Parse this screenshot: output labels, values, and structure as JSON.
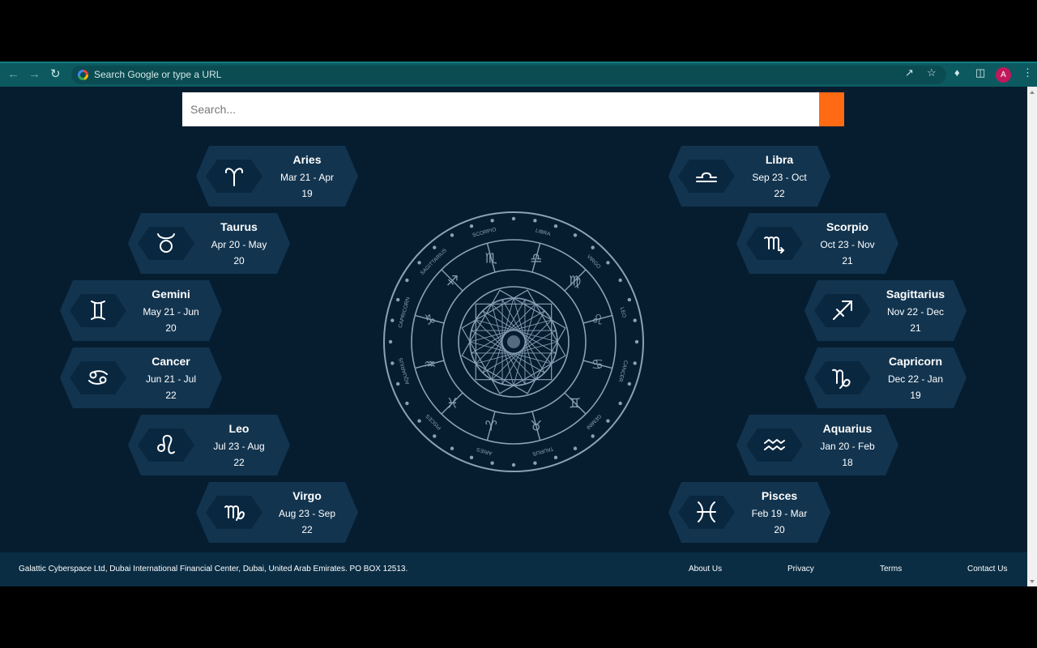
{
  "browser": {
    "omnibox_placeholder": "Search Google or type a URL",
    "profile_initial": "A"
  },
  "search": {
    "placeholder": "Search...",
    "button_color": "#ff6a13"
  },
  "colors": {
    "page_background": "#061d30",
    "card_background": "#12344f",
    "footer_background": "#0a2d44",
    "chrome_background": "#0c5a60"
  },
  "signs": [
    {
      "name": "Aries",
      "dates_line1": "Mar 21 - Apr",
      "dates_line2": "19",
      "icon": "aries-icon"
    },
    {
      "name": "Taurus",
      "dates_line1": "Apr 20 - May",
      "dates_line2": "20",
      "icon": "taurus-icon"
    },
    {
      "name": "Gemini",
      "dates_line1": "May 21 - Jun",
      "dates_line2": "20",
      "icon": "gemini-icon"
    },
    {
      "name": "Cancer",
      "dates_line1": "Jun 21 - Jul",
      "dates_line2": "22",
      "icon": "cancer-icon"
    },
    {
      "name": "Leo",
      "dates_line1": "Jul 23 - Aug",
      "dates_line2": "22",
      "icon": "leo-icon"
    },
    {
      "name": "Virgo",
      "dates_line1": "Aug 23 - Sep",
      "dates_line2": "22",
      "icon": "virgo-icon"
    },
    {
      "name": "Libra",
      "dates_line1": "Sep 23 - Oct",
      "dates_line2": "22",
      "icon": "libra-icon"
    },
    {
      "name": "Scorpio",
      "dates_line1": "Oct 23 - Nov",
      "dates_line2": "21",
      "icon": "scorpio-icon"
    },
    {
      "name": "Sagittarius",
      "dates_line1": "Nov 22 - Dec",
      "dates_line2": "21",
      "icon": "sagittarius-icon"
    },
    {
      "name": "Capricorn",
      "dates_line1": "Dec 22 - Jan",
      "dates_line2": "19",
      "icon": "capricorn-icon"
    },
    {
      "name": "Aquarius",
      "dates_line1": "Jan 20 - Feb",
      "dates_line2": "18",
      "icon": "aquarius-icon"
    },
    {
      "name": "Pisces",
      "dates_line1": "Feb 19 - Mar",
      "dates_line2": "20",
      "icon": "pisces-icon"
    }
  ],
  "wheel": {
    "ring_labels": [
      "SCORPIO",
      "LIBRA",
      "VIRGO",
      "LEO",
      "CANCER",
      "GEMINI",
      "TAURUS",
      "ARIES",
      "PISCES",
      "AQUARIUS",
      "CAPRICORN",
      "SAGITTARIUS"
    ],
    "glyphs": [
      "♏",
      "♎",
      "♍",
      "♌",
      "♋",
      "♊",
      "♉",
      "♈",
      "♓",
      "♒",
      "♑",
      "♐"
    ]
  },
  "footer": {
    "address": "Galattic Cyberspace Ltd, Dubai International Financial Center, Dubai, United Arab Emirates. PO BOX 12513.",
    "links": [
      "About Us",
      "Privacy",
      "Terms",
      "Contact Us"
    ]
  }
}
